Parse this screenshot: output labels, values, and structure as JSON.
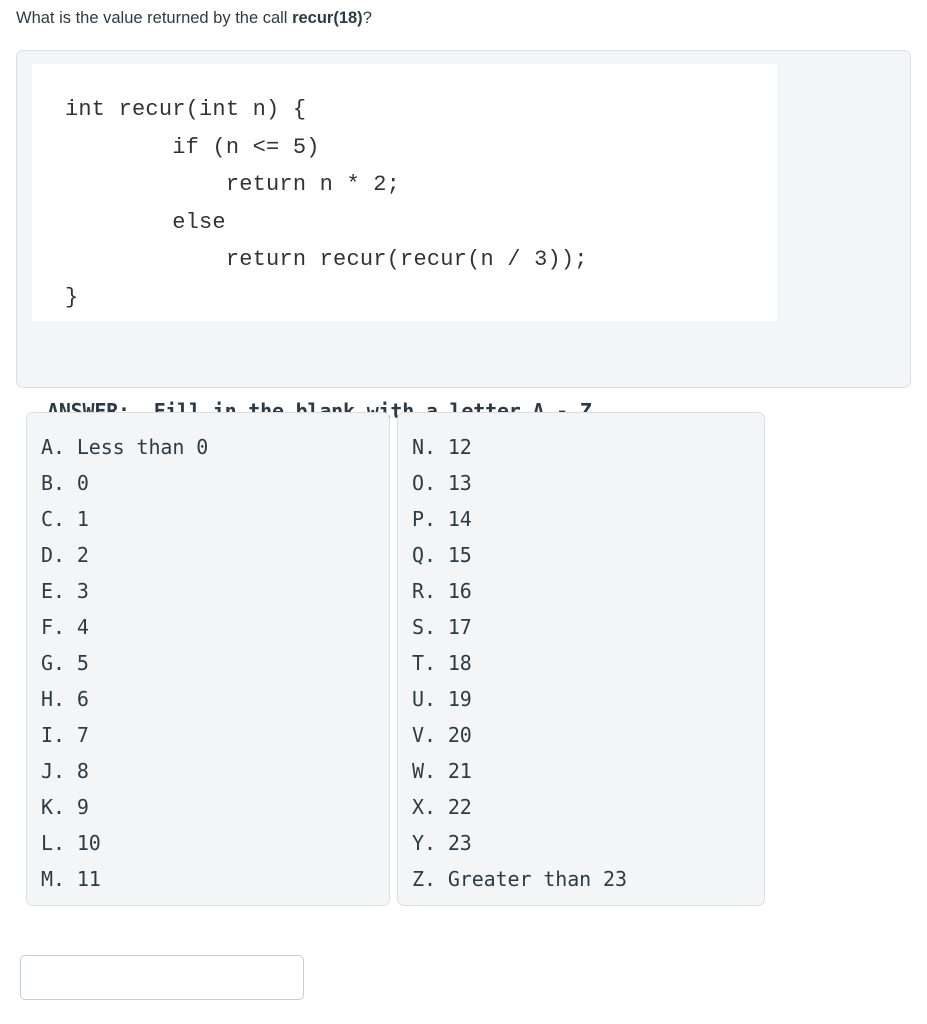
{
  "question": {
    "prefix": "What is the value returned by the call ",
    "bold": "recur(18)",
    "suffix": "?"
  },
  "code": {
    "text": "int recur(int n) {\n        if (n <= 5)\n            return n * 2;\n        else\n            return recur(recur(n / 3));\n}"
  },
  "answer_instruction": "ANSWER:  Fill in the blank with a letter A - Z",
  "options_left": [
    "A. Less than 0",
    "B. 0",
    "C. 1",
    "D. 2",
    "E. 3",
    "F. 4",
    "G. 5",
    "H. 6",
    "I. 7",
    "J. 8",
    "K. 9",
    "L. 10",
    "M. 11"
  ],
  "options_right": [
    "N. 12",
    "O. 13",
    "P. 14",
    "Q. 15",
    "R. 16",
    "S. 17",
    "T. 18",
    "U. 19",
    "V. 20",
    "W. 21",
    "X. 22",
    "Y. 23",
    "Z. Greater than 23"
  ],
  "answer_field": {
    "value": "",
    "placeholder": ""
  },
  "colors": {
    "text": "#2d3b45",
    "code_text": "#333333",
    "card_background": "#f4f5f6",
    "card_border": "#dcdfe2",
    "input_border": "#c7cdd1",
    "page_background": "#ffffff"
  }
}
